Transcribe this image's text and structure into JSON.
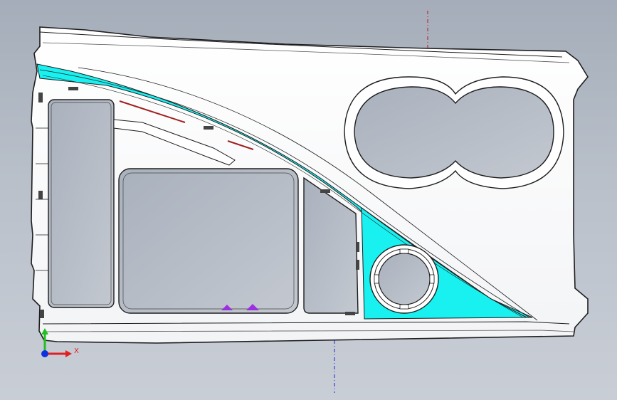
{
  "viewport": {
    "background_top": "#a4adb9",
    "background_bottom": "#c9ced6"
  },
  "part": {
    "body_fill": "#ffffff",
    "edge_color": "#1e1e1e",
    "cavity_fill": "#b7bec8",
    "highlight_face_color": "#19f0f0",
    "rib_accent_color": "#a0201e",
    "clip_color": "#9b30e0",
    "centerline_red": "#c0102a",
    "centerline_blue": "#2020d0"
  },
  "triad": {
    "x_label": "X",
    "x_color": "#e02020",
    "y_color": "#20c020",
    "origin_color": "#1030e0"
  }
}
